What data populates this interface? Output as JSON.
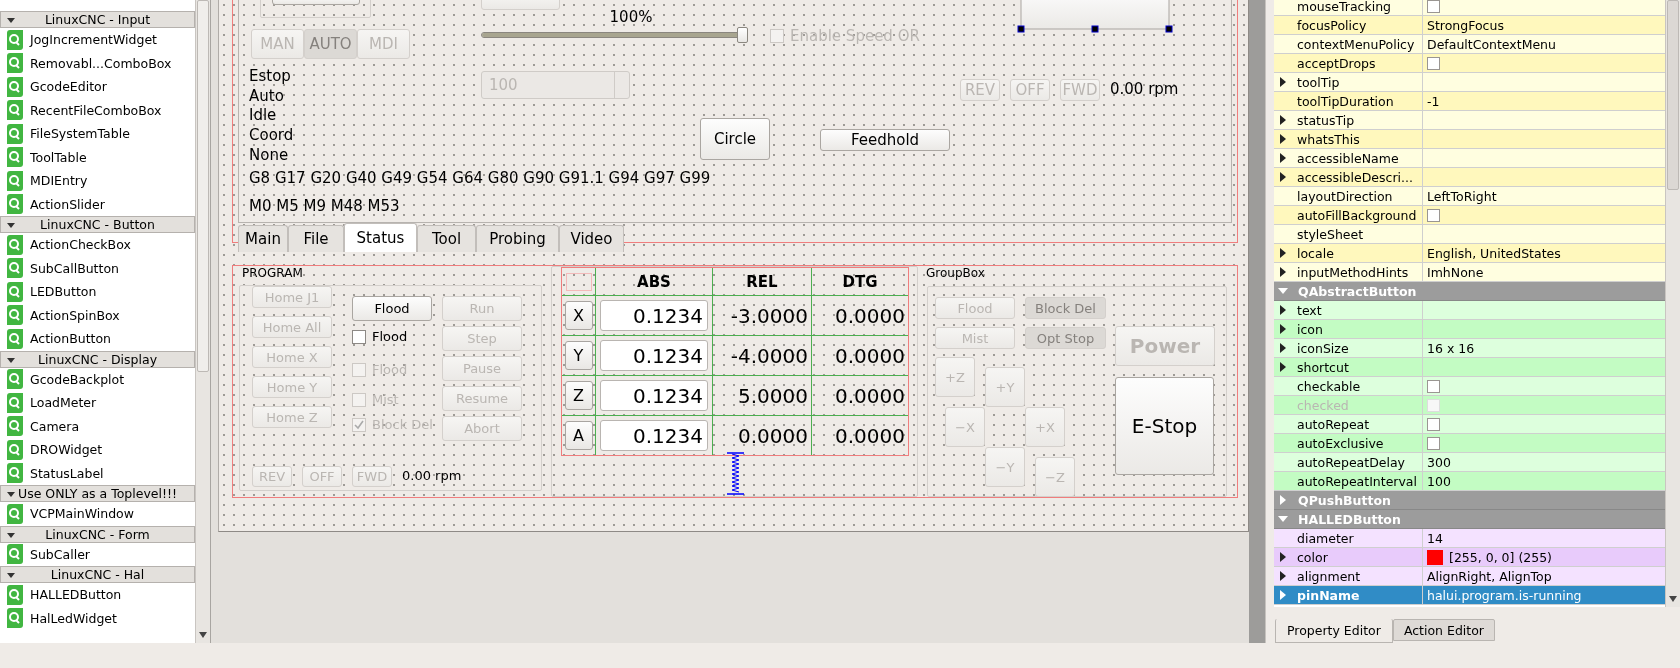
{
  "widget_box": {
    "groups": [
      {
        "title": "LinuxCNC - Input",
        "expanded": true,
        "items": [
          "JogIncrementWidget",
          "Removabl...ComboBox",
          "GcodeEditor",
          "RecentFileComboBox",
          "FileSystemTable",
          "ToolTable",
          "MDIEntry",
          "ActionSlider"
        ]
      },
      {
        "title": "LinuxCNC - Button",
        "expanded": true,
        "items": [
          "ActionCheckBox",
          "SubCallButton",
          "LEDButton",
          "ActionSpinBox",
          "ActionButton"
        ]
      },
      {
        "title": "LinuxCNC - Display",
        "expanded": true,
        "items": [
          "GcodeBackplot",
          "LoadMeter",
          "Camera",
          "DROWidget",
          "StatusLabel"
        ]
      },
      {
        "title": "Use ONLY as a Toplevel!!!",
        "expanded": true,
        "items": [
          "VCPMainWindow"
        ]
      },
      {
        "title": "LinuxCNC - Form",
        "expanded": true,
        "items": [
          "SubCaller"
        ]
      },
      {
        "title": "LinuxCNC - Hal",
        "expanded": true,
        "items": [
          "HALLEDButton",
          "HalLedWidget"
        ]
      }
    ]
  },
  "form": {
    "top_panel": {
      "speed_label": "100%",
      "speed_slider": {
        "level": 1
      },
      "speed_override": {
        "label": "Enable Speed OR",
        "checked": false,
        "disabled": true
      },
      "mode_buttons": [
        {
          "label": "MAN",
          "selected": false
        },
        {
          "label": "AUTO",
          "selected": true
        },
        {
          "label": "MDI",
          "selected": false
        }
      ],
      "status_labels": [
        "Estop",
        "Auto",
        "Idle",
        "Coord",
        "None"
      ],
      "gcodes": "G8 G17 G20 G40 G49 G54 G64 G80 G90 G91.1 G94 G97 G99",
      "mcodes": "M0 M5 M9 M48 M53",
      "spinbox": {
        "value": "100",
        "disabled": true
      },
      "circle_button": "Circle",
      "feedhold_button": "Feedhold",
      "spindle": {
        "buttons": [
          {
            "label": "REV",
            "disabled": true
          },
          {
            "label": "OFF",
            "disabled": true
          },
          {
            "label": "FWD",
            "disabled": true
          }
        ],
        "speed": "0.00 rpm"
      }
    },
    "tabs": [
      {
        "label": "Main",
        "selected": false
      },
      {
        "label": "File",
        "selected": false
      },
      {
        "label": "Status",
        "selected": true
      },
      {
        "label": "Tool",
        "selected": false
      },
      {
        "label": "Probing",
        "selected": false
      },
      {
        "label": "Video",
        "selected": false
      }
    ],
    "program_group": {
      "title": "PROGRAM",
      "home_buttons": [
        {
          "label": "Home J1",
          "disabled": true
        },
        {
          "label": "Home All",
          "disabled": true
        },
        {
          "label": "Home X",
          "disabled": true
        },
        {
          "label": "Home Y",
          "disabled": true
        },
        {
          "label": "Home Z",
          "disabled": true
        }
      ],
      "flood_button": {
        "label": "Flood",
        "disabled": false
      },
      "checkboxes": [
        {
          "label": "Flood",
          "checked": false,
          "disabled": false
        },
        {
          "label": "Flood",
          "checked": false,
          "disabled": true
        },
        {
          "label": "Mist",
          "checked": false,
          "disabled": true
        },
        {
          "label": "Block Del",
          "checked": true,
          "disabled": true
        }
      ],
      "program_buttons": [
        {
          "label": "Run",
          "disabled": true
        },
        {
          "label": "Step",
          "disabled": true
        },
        {
          "label": "Pause",
          "disabled": true
        },
        {
          "label": "Resume",
          "disabled": true
        },
        {
          "label": "Abort",
          "disabled": true
        }
      ],
      "spindle": {
        "buttons": [
          {
            "label": "REV",
            "disabled": true
          },
          {
            "label": "OFF",
            "disabled": true
          },
          {
            "label": "FWD",
            "disabled": true
          }
        ],
        "speed": "0.00 rpm"
      }
    },
    "dro": {
      "columns": [
        "ABS",
        "REL",
        "DTG"
      ],
      "rows": [
        {
          "axis": "X",
          "abs": "0.1234",
          "rel": "-3.0000",
          "dtg": "0.0000"
        },
        {
          "axis": "Y",
          "abs": "0.1234",
          "rel": "-4.0000",
          "dtg": "0.0000"
        },
        {
          "axis": "Z",
          "abs": "0.1234",
          "rel": "5.0000",
          "dtg": "0.0000"
        },
        {
          "axis": "A",
          "abs": "0.1234",
          "rel": "0.0000",
          "dtg": "0.0000"
        }
      ]
    },
    "control_group": {
      "title": "GroupBox",
      "toggle_buttons": [
        {
          "label": "Flood",
          "checked": false
        },
        {
          "label": "Block Del",
          "checked": true
        },
        {
          "label": "Mist",
          "checked": false
        },
        {
          "label": "Opt Stop",
          "checked": true
        }
      ],
      "jog_buttons": [
        "+Z",
        "+Y",
        "−X",
        "+X",
        "−Y",
        "−Z"
      ],
      "power_button": {
        "label": "Power",
        "disabled": true
      },
      "estop_button": {
        "label": "E-Stop",
        "disabled": false
      }
    }
  },
  "property_editor": {
    "groups": [
      {
        "rows": [
          {
            "name": "mouseTracking",
            "expandable": false,
            "kind": "checkbox",
            "checked": false,
            "disabled": false,
            "selected": false
          },
          {
            "name": "focusPolicy",
            "expandable": false,
            "kind": "text",
            "value": "StrongFocus",
            "disabled": false,
            "selected": false
          },
          {
            "name": "contextMenuPolicy",
            "expandable": false,
            "kind": "text",
            "value": "DefaultContextMenu",
            "disabled": false,
            "selected": false
          },
          {
            "name": "acceptDrops",
            "expandable": false,
            "kind": "checkbox",
            "checked": false,
            "disabled": false,
            "selected": false
          },
          {
            "name": "toolTip",
            "expandable": true,
            "kind": "text",
            "disabled": false,
            "selected": false
          },
          {
            "name": "toolTipDuration",
            "expandable": false,
            "kind": "text",
            "value": "-1",
            "disabled": false,
            "selected": false
          },
          {
            "name": "statusTip",
            "expandable": true,
            "kind": "text",
            "disabled": false,
            "selected": false
          },
          {
            "name": "whatsThis",
            "expandable": true,
            "kind": "text",
            "disabled": false,
            "selected": false
          },
          {
            "name": "accessibleName",
            "expandable": true,
            "kind": "text",
            "disabled": false,
            "selected": false
          },
          {
            "name": "accessibleDescri...",
            "expandable": true,
            "kind": "text",
            "disabled": false,
            "selected": false
          },
          {
            "name": "layoutDirection",
            "expandable": false,
            "kind": "text",
            "value": "LeftToRight",
            "disabled": false,
            "selected": false
          },
          {
            "name": "autoFillBackground",
            "expandable": false,
            "kind": "checkbox",
            "checked": false,
            "disabled": false,
            "selected": false
          },
          {
            "name": "styleSheet",
            "expandable": false,
            "kind": "text",
            "disabled": false,
            "selected": false
          },
          {
            "name": "locale",
            "expandable": true,
            "kind": "text",
            "value": "English, UnitedStates",
            "disabled": false,
            "selected": false
          },
          {
            "name": "inputMethodHints",
            "expandable": true,
            "kind": "text",
            "value": "ImhNone",
            "disabled": false,
            "selected": false
          }
        ]
      },
      {
        "title": "QAbstractButton",
        "expanded": true,
        "rows": [
          {
            "name": "text",
            "expandable": true,
            "kind": "text",
            "disabled": false,
            "selected": false
          },
          {
            "name": "icon",
            "expandable": true,
            "kind": "text",
            "disabled": false,
            "selected": false
          },
          {
            "name": "iconSize",
            "expandable": true,
            "kind": "text",
            "value": "16 x 16",
            "disabled": false,
            "selected": false
          },
          {
            "name": "shortcut",
            "expandable": true,
            "kind": "text",
            "disabled": false,
            "selected": false
          },
          {
            "name": "checkable",
            "expandable": false,
            "kind": "checkbox",
            "checked": false,
            "disabled": false,
            "selected": false
          },
          {
            "name": "checked",
            "expandable": false,
            "kind": "checkbox",
            "checked": false,
            "disabled": true,
            "selected": false
          },
          {
            "name": "autoRepeat",
            "expandable": false,
            "kind": "checkbox",
            "checked": false,
            "disabled": false,
            "selected": false
          },
          {
            "name": "autoExclusive",
            "expandable": false,
            "kind": "checkbox",
            "checked": false,
            "disabled": false,
            "selected": false
          },
          {
            "name": "autoRepeatDelay",
            "expandable": false,
            "kind": "text",
            "value": "300",
            "disabled": false,
            "selected": false
          },
          {
            "name": "autoRepeatInterval",
            "expandable": false,
            "kind": "text",
            "value": "100",
            "disabled": false,
            "selected": false
          }
        ]
      },
      {
        "title": "QPushButton",
        "expanded": false
      },
      {
        "title": "HALLEDButton",
        "expanded": true,
        "rows": [
          {
            "name": "diameter",
            "expandable": false,
            "kind": "text",
            "value": "14",
            "disabled": false,
            "selected": false
          },
          {
            "name": "color",
            "expandable": true,
            "kind": "color",
            "color": "#ff0000",
            "value": "[255, 0, 0] (255)",
            "disabled": false,
            "selected": false
          },
          {
            "name": "alignment",
            "expandable": true,
            "kind": "text",
            "value": "AlignRight, AlignTop",
            "disabled": false,
            "selected": false
          },
          {
            "name": "pinName",
            "expandable": true,
            "kind": "text",
            "value": "halui.program.is-running",
            "disabled": false,
            "selected": true
          }
        ]
      }
    ],
    "tabs": [
      {
        "label": "Property Editor",
        "selected": true
      },
      {
        "label": "Action Editor",
        "selected": false
      }
    ]
  }
}
